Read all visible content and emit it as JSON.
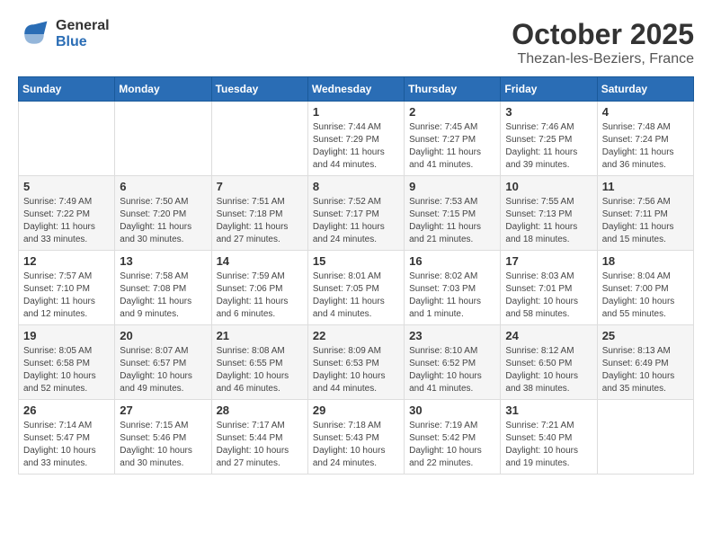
{
  "logo": {
    "general": "General",
    "blue": "Blue"
  },
  "header": {
    "month": "October 2025",
    "location": "Thezan-les-Beziers, France"
  },
  "weekdays": [
    "Sunday",
    "Monday",
    "Tuesday",
    "Wednesday",
    "Thursday",
    "Friday",
    "Saturday"
  ],
  "weeks": [
    [
      null,
      null,
      null,
      {
        "day": 1,
        "sunrise": "7:44 AM",
        "sunset": "7:29 PM",
        "daylight": "11 hours and 44 minutes."
      },
      {
        "day": 2,
        "sunrise": "7:45 AM",
        "sunset": "7:27 PM",
        "daylight": "11 hours and 41 minutes."
      },
      {
        "day": 3,
        "sunrise": "7:46 AM",
        "sunset": "7:25 PM",
        "daylight": "11 hours and 39 minutes."
      },
      {
        "day": 4,
        "sunrise": "7:48 AM",
        "sunset": "7:24 PM",
        "daylight": "11 hours and 36 minutes."
      }
    ],
    [
      {
        "day": 5,
        "sunrise": "7:49 AM",
        "sunset": "7:22 PM",
        "daylight": "11 hours and 33 minutes."
      },
      {
        "day": 6,
        "sunrise": "7:50 AM",
        "sunset": "7:20 PM",
        "daylight": "11 hours and 30 minutes."
      },
      {
        "day": 7,
        "sunrise": "7:51 AM",
        "sunset": "7:18 PM",
        "daylight": "11 hours and 27 minutes."
      },
      {
        "day": 8,
        "sunrise": "7:52 AM",
        "sunset": "7:17 PM",
        "daylight": "11 hours and 24 minutes."
      },
      {
        "day": 9,
        "sunrise": "7:53 AM",
        "sunset": "7:15 PM",
        "daylight": "11 hours and 21 minutes."
      },
      {
        "day": 10,
        "sunrise": "7:55 AM",
        "sunset": "7:13 PM",
        "daylight": "11 hours and 18 minutes."
      },
      {
        "day": 11,
        "sunrise": "7:56 AM",
        "sunset": "7:11 PM",
        "daylight": "11 hours and 15 minutes."
      }
    ],
    [
      {
        "day": 12,
        "sunrise": "7:57 AM",
        "sunset": "7:10 PM",
        "daylight": "11 hours and 12 minutes."
      },
      {
        "day": 13,
        "sunrise": "7:58 AM",
        "sunset": "7:08 PM",
        "daylight": "11 hours and 9 minutes."
      },
      {
        "day": 14,
        "sunrise": "7:59 AM",
        "sunset": "7:06 PM",
        "daylight": "11 hours and 6 minutes."
      },
      {
        "day": 15,
        "sunrise": "8:01 AM",
        "sunset": "7:05 PM",
        "daylight": "11 hours and 4 minutes."
      },
      {
        "day": 16,
        "sunrise": "8:02 AM",
        "sunset": "7:03 PM",
        "daylight": "11 hours and 1 minute."
      },
      {
        "day": 17,
        "sunrise": "8:03 AM",
        "sunset": "7:01 PM",
        "daylight": "10 hours and 58 minutes."
      },
      {
        "day": 18,
        "sunrise": "8:04 AM",
        "sunset": "7:00 PM",
        "daylight": "10 hours and 55 minutes."
      }
    ],
    [
      {
        "day": 19,
        "sunrise": "8:05 AM",
        "sunset": "6:58 PM",
        "daylight": "10 hours and 52 minutes."
      },
      {
        "day": 20,
        "sunrise": "8:07 AM",
        "sunset": "6:57 PM",
        "daylight": "10 hours and 49 minutes."
      },
      {
        "day": 21,
        "sunrise": "8:08 AM",
        "sunset": "6:55 PM",
        "daylight": "10 hours and 46 minutes."
      },
      {
        "day": 22,
        "sunrise": "8:09 AM",
        "sunset": "6:53 PM",
        "daylight": "10 hours and 44 minutes."
      },
      {
        "day": 23,
        "sunrise": "8:10 AM",
        "sunset": "6:52 PM",
        "daylight": "10 hours and 41 minutes."
      },
      {
        "day": 24,
        "sunrise": "8:12 AM",
        "sunset": "6:50 PM",
        "daylight": "10 hours and 38 minutes."
      },
      {
        "day": 25,
        "sunrise": "8:13 AM",
        "sunset": "6:49 PM",
        "daylight": "10 hours and 35 minutes."
      }
    ],
    [
      {
        "day": 26,
        "sunrise": "7:14 AM",
        "sunset": "5:47 PM",
        "daylight": "10 hours and 33 minutes."
      },
      {
        "day": 27,
        "sunrise": "7:15 AM",
        "sunset": "5:46 PM",
        "daylight": "10 hours and 30 minutes."
      },
      {
        "day": 28,
        "sunrise": "7:17 AM",
        "sunset": "5:44 PM",
        "daylight": "10 hours and 27 minutes."
      },
      {
        "day": 29,
        "sunrise": "7:18 AM",
        "sunset": "5:43 PM",
        "daylight": "10 hours and 24 minutes."
      },
      {
        "day": 30,
        "sunrise": "7:19 AM",
        "sunset": "5:42 PM",
        "daylight": "10 hours and 22 minutes."
      },
      {
        "day": 31,
        "sunrise": "7:21 AM",
        "sunset": "5:40 PM",
        "daylight": "10 hours and 19 minutes."
      },
      null
    ]
  ]
}
